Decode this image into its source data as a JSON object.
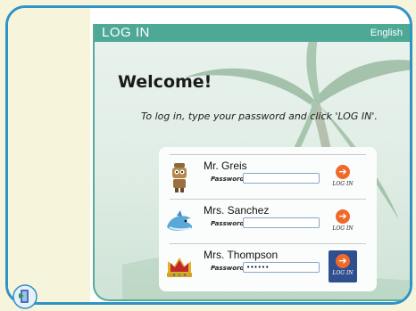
{
  "window": {
    "title": "LOG IN",
    "language": "English",
    "extra": "-"
  },
  "welcome": "Welcome!",
  "instructions": "To log in, type your password and click 'LOG IN'.",
  "users": [
    {
      "name": "Mr. Greis",
      "password_label": "Password:",
      "password_value": "",
      "login_label": "LOG IN"
    },
    {
      "name": "Mrs. Sanchez",
      "password_label": "Password:",
      "password_value": "",
      "login_label": "LOG IN"
    },
    {
      "name": "Mrs. Thompson",
      "password_label": "Password:",
      "password_value": "••••••",
      "login_label": "LOG IN"
    }
  ],
  "colors": {
    "frame": "#2f93c6",
    "titlebar": "#4ea896",
    "login_orange": "#ef6a2a",
    "active_button": "#2f4f8f"
  },
  "icons": {
    "login": "arrow-right-circle-icon",
    "app": "app-launcher-icon"
  }
}
